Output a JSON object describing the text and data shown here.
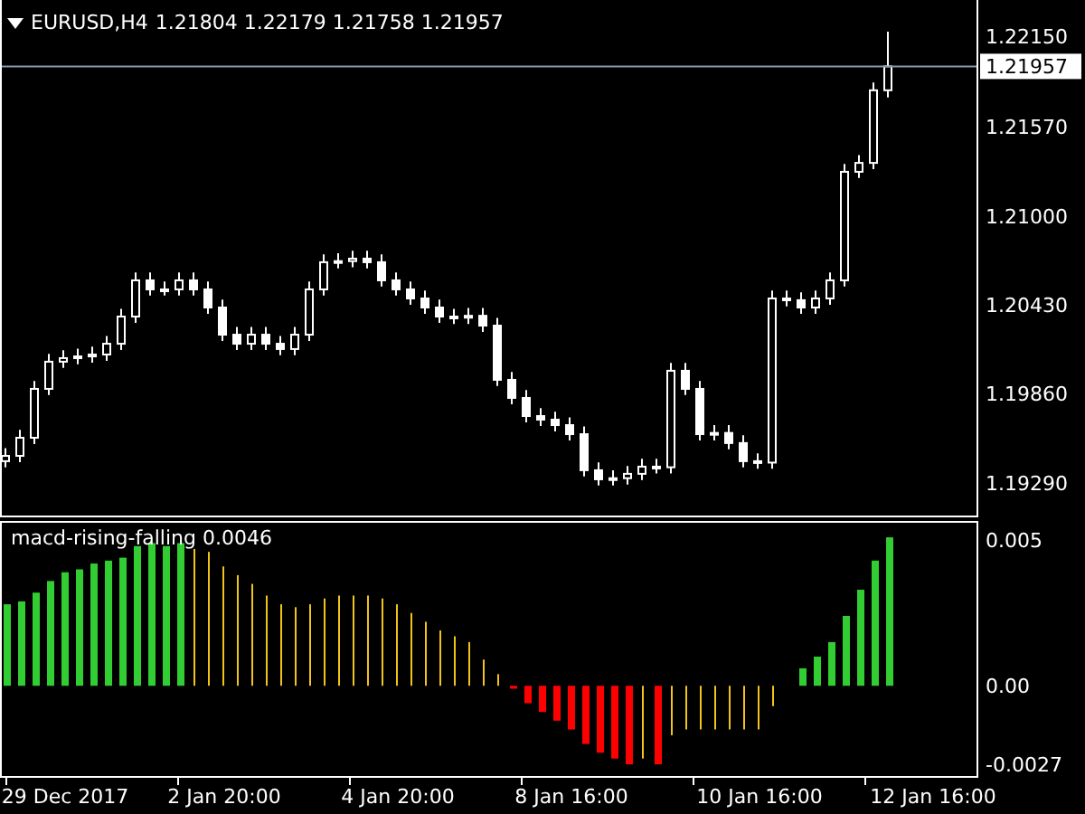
{
  "header": {
    "symbol": "EURUSD,H4",
    "quotes": "1.21804 1.22179 1.21758 1.21957"
  },
  "main_chart": {
    "current_price": "1.21957",
    "chart_data": {
      "type": "candlestick",
      "ylim": [
        1.19081,
        1.22382
      ],
      "ref_lines": [
        {
          "axis": "y",
          "value": 1.21957,
          "color": "#8899aa"
        }
      ],
      "yticks": [
        {
          "value": 1.2215,
          "label": "1.22150"
        },
        {
          "value": 1.2157,
          "label": "1.21570"
        },
        {
          "value": 1.21,
          "label": "1.21000"
        },
        {
          "value": 1.2043,
          "label": "1.20430"
        },
        {
          "value": 1.1986,
          "label": "1.19860"
        },
        {
          "value": 1.1929,
          "label": "1.19290"
        }
      ],
      "categories": [
        null,
        null,
        null,
        null,
        null,
        null,
        null,
        null,
        null,
        null,
        null,
        null,
        null,
        null,
        null,
        null,
        null,
        null,
        null,
        null,
        null,
        null,
        null,
        null,
        null,
        null,
        null,
        null,
        null,
        null,
        null,
        null,
        null,
        null,
        null,
        null,
        null,
        null,
        null,
        null,
        null,
        null,
        null,
        null,
        null,
        null,
        null,
        null,
        null,
        null,
        null,
        null,
        null,
        null,
        null,
        null,
        null,
        null,
        null,
        null,
        null,
        null
      ],
      "ohlc": [
        [
          1.19429,
          1.19513,
          1.19389,
          1.19463
        ],
        [
          1.19463,
          1.19629,
          1.19423,
          1.19579
        ],
        [
          1.19579,
          1.19942,
          1.19539,
          1.19892
        ],
        [
          1.19892,
          1.20116,
          1.19852,
          1.20066
        ],
        [
          1.20066,
          1.20139,
          1.20026,
          1.20089
        ],
        [
          1.20089,
          1.2015,
          1.20049,
          1.201
        ],
        [
          1.201,
          1.20162,
          1.2006,
          1.20112
        ],
        [
          1.20112,
          1.20231,
          1.20072,
          1.20181
        ],
        [
          1.20181,
          1.20405,
          1.20141,
          1.20355
        ],
        [
          1.20355,
          1.20637,
          1.20315,
          1.20587
        ],
        [
          1.20587,
          1.20637,
          1.20489,
          1.20529
        ],
        [
          1.20529,
          1.20579,
          1.20489,
          1.20529
        ],
        [
          1.20529,
          1.20637,
          1.20489,
          1.20587
        ],
        [
          1.20587,
          1.20637,
          1.20489,
          1.20529
        ],
        [
          1.20529,
          1.20579,
          1.20373,
          1.20413
        ],
        [
          1.20413,
          1.20463,
          1.20199,
          1.20239
        ],
        [
          1.20239,
          1.20289,
          1.20141,
          1.20181
        ],
        [
          1.20181,
          1.20289,
          1.20141,
          1.20239
        ],
        [
          1.20239,
          1.20289,
          1.20141,
          1.20181
        ],
        [
          1.20181,
          1.20231,
          1.20107,
          1.20147
        ],
        [
          1.20147,
          1.20289,
          1.20107,
          1.20239
        ],
        [
          1.20239,
          1.20579,
          1.20199,
          1.20529
        ],
        [
          1.20529,
          1.20753,
          1.20489,
          1.20703
        ],
        [
          1.20703,
          1.2076,
          1.20663,
          1.2071
        ],
        [
          1.2071,
          1.20776,
          1.2067,
          1.20726
        ],
        [
          1.20726,
          1.20776,
          1.20663,
          1.20703
        ],
        [
          1.20703,
          1.20753,
          1.20547,
          1.20587
        ],
        [
          1.20587,
          1.20637,
          1.20489,
          1.20529
        ],
        [
          1.20529,
          1.20579,
          1.20431,
          1.20471
        ],
        [
          1.20471,
          1.20521,
          1.20373,
          1.20413
        ],
        [
          1.20413,
          1.20463,
          1.20315,
          1.20355
        ],
        [
          1.20355,
          1.20405,
          1.20308,
          1.20348
        ],
        [
          1.20348,
          1.2041,
          1.20308,
          1.2036
        ],
        [
          1.2036,
          1.2041,
          1.20257,
          1.20297
        ],
        [
          1.20297,
          1.20347,
          1.1991,
          1.1995
        ],
        [
          1.1995,
          1.2,
          1.19794,
          1.19834
        ],
        [
          1.19834,
          1.19884,
          1.19678,
          1.19718
        ],
        [
          1.19718,
          1.19768,
          1.19655,
          1.19695
        ],
        [
          1.19695,
          1.19745,
          1.1962,
          1.1966
        ],
        [
          1.1966,
          1.1971,
          1.19562,
          1.19602
        ],
        [
          1.19602,
          1.19652,
          1.19331,
          1.19371
        ],
        [
          1.19371,
          1.19421,
          1.19273,
          1.19313
        ],
        [
          1.19313,
          1.1937,
          1.19273,
          1.1932
        ],
        [
          1.1932,
          1.19398,
          1.1928,
          1.19348
        ],
        [
          1.19348,
          1.19444,
          1.19308,
          1.19394
        ],
        [
          1.19394,
          1.19444,
          1.1935,
          1.1939
        ],
        [
          1.1939,
          1.20058,
          1.1935,
          1.20008
        ],
        [
          1.20008,
          1.20058,
          1.19852,
          1.19892
        ],
        [
          1.19892,
          1.19942,
          1.19562,
          1.19602
        ],
        [
          1.19602,
          1.1966,
          1.19562,
          1.1961
        ],
        [
          1.1961,
          1.1966,
          1.19505,
          1.19545
        ],
        [
          1.19545,
          1.19595,
          1.19389,
          1.19429
        ],
        [
          1.19429,
          1.19479,
          1.1938,
          1.1942
        ],
        [
          1.1942,
          1.20521,
          1.1938,
          1.20471
        ],
        [
          1.20471,
          1.20521,
          1.2042,
          1.2046
        ],
        [
          1.2046,
          1.2051,
          1.20373,
          1.20413
        ],
        [
          1.20413,
          1.20521,
          1.20373,
          1.20471
        ],
        [
          1.20471,
          1.20637,
          1.20431,
          1.20587
        ],
        [
          1.20587,
          1.21332,
          1.20547,
          1.21282
        ],
        [
          1.21282,
          1.21389,
          1.21242,
          1.21339
        ],
        [
          1.21339,
          1.21854,
          1.21299,
          1.21804
        ],
        [
          1.21804,
          1.22179,
          1.21758,
          1.21957
        ]
      ]
    }
  },
  "indicator": {
    "chart_data": {
      "type": "bar",
      "stacked": true,
      "title": "macd-rising-falling 0.0046",
      "ylim": [
        -0.0031,
        0.0056
      ],
      "yticks": [
        {
          "value": 0.005,
          "label": "0.005"
        },
        {
          "value": 0,
          "label": "0.00"
        },
        {
          "value": -0.0027,
          "label": "-0.0027"
        }
      ],
      "categories": [
        null,
        null,
        null,
        null,
        "29 Dec 2017",
        null,
        null,
        null,
        null,
        null,
        null,
        null,
        null,
        null,
        null,
        "2 Jan 20:00",
        null,
        null,
        null,
        null,
        null,
        null,
        null,
        null,
        null,
        null,
        null,
        "4 Jan 20:00",
        null,
        null,
        null,
        null,
        null,
        null,
        null,
        null,
        null,
        null,
        null,
        "8 Jan 16:00",
        null,
        null,
        null,
        null,
        null,
        null,
        null,
        null,
        null,
        null,
        null,
        null,
        "10 Jan 16:00",
        null,
        null,
        null,
        null,
        null,
        null,
        null,
        null,
        null,
        null,
        null,
        "12 Jan 16:00",
        null,
        null
      ],
      "series": [
        {
          "color": "#32cd32",
          "values": [
            0.0028,
            0.0029,
            0.0032,
            0.0036,
            0.0039,
            0.004,
            0.0042,
            0.0043,
            0.0044,
            0.0048,
            0.0049,
            0.0048,
            0.0049,
            null,
            null,
            null,
            null,
            null,
            null,
            null,
            null,
            null,
            null,
            null,
            null,
            null,
            null,
            null,
            null,
            null,
            null,
            null,
            null,
            null,
            null,
            null,
            null,
            null,
            null,
            null,
            null,
            null,
            null,
            null,
            null,
            null,
            null,
            null,
            null,
            null,
            null,
            null,
            null,
            null,
            null,
            0.0006,
            0.001,
            0.0015,
            0.0024,
            0.0033,
            0.0043,
            0.0051,
            null,
            null,
            null,
            null,
            null
          ]
        },
        {
          "color": "#f0c419",
          "values": [
            null,
            null,
            null,
            null,
            null,
            null,
            null,
            null,
            null,
            null,
            null,
            null,
            null,
            0.0047,
            0.0046,
            0.0041,
            0.0038,
            0.0035,
            0.0031,
            0.0028,
            0.0027,
            0.0028,
            0.003,
            0.0031,
            0.0031,
            0.0031,
            0.003,
            0.0028,
            0.0025,
            0.0022,
            0.0019,
            0.0017,
            0.0015,
            0.0009,
            0.0004,
            null,
            null,
            null,
            null,
            null,
            null,
            null,
            null,
            null,
            -0.0025,
            null,
            -0.0017,
            -0.0015,
            -0.0015,
            -0.0015,
            -0.0015,
            -0.0015,
            -0.0015,
            -0.0007,
            null,
            null,
            null,
            null,
            null,
            null,
            null,
            null,
            null,
            null,
            null,
            null,
            null
          ]
        },
        {
          "color": "#ff0000",
          "values": [
            null,
            null,
            null,
            null,
            null,
            null,
            null,
            null,
            null,
            null,
            null,
            null,
            null,
            null,
            null,
            null,
            null,
            null,
            null,
            null,
            null,
            null,
            null,
            null,
            null,
            null,
            null,
            null,
            null,
            null,
            null,
            null,
            null,
            null,
            null,
            -0.0001,
            -0.0006,
            -0.0009,
            -0.0012,
            -0.0015,
            -0.002,
            -0.0023,
            -0.0025,
            -0.0027,
            null,
            -0.0027,
            null,
            null,
            null,
            null,
            null,
            null,
            null,
            null,
            null,
            null,
            null,
            null,
            null,
            null,
            null,
            null,
            null,
            null,
            null,
            null,
            null
          ]
        }
      ]
    }
  }
}
